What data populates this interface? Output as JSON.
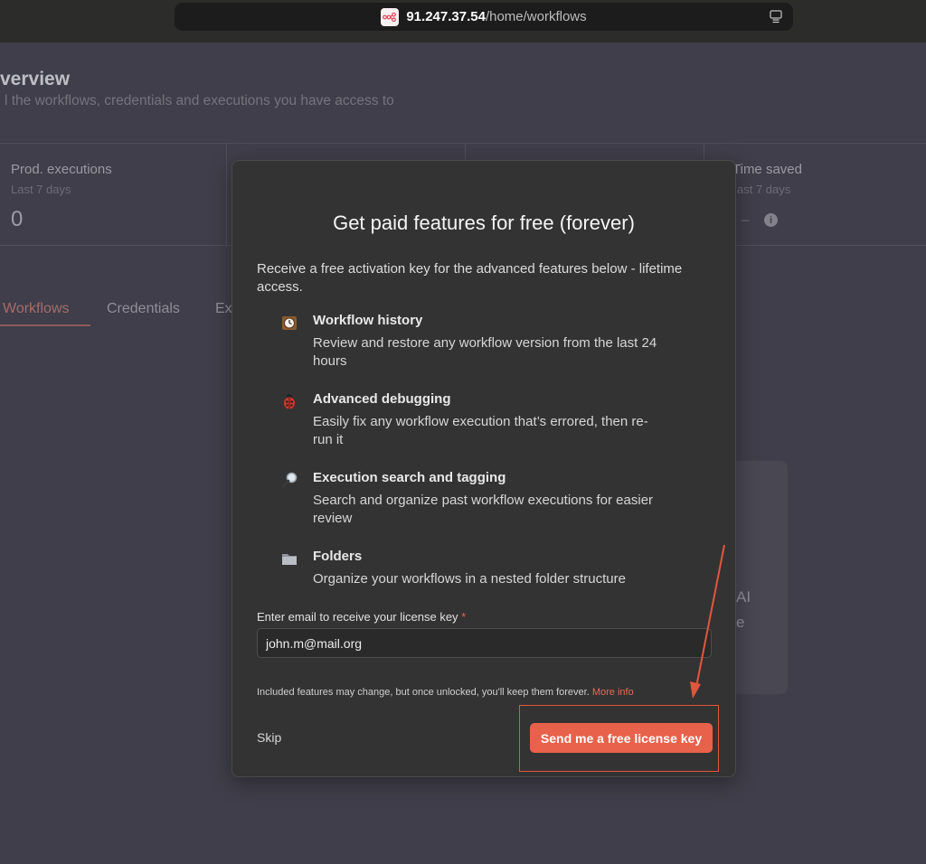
{
  "browser": {
    "url_host": "91.247.37.54",
    "url_path": "/home/workflows"
  },
  "background": {
    "title": "verview",
    "subtitle": "l the workflows, credentials and executions you have access to",
    "stats": [
      {
        "label": "Prod. executions",
        "sub": "Last 7 days",
        "value": "0"
      },
      {
        "label": "Time saved",
        "sub": "ast 7 days",
        "value": "–"
      }
    ],
    "tabs": [
      "Workflows",
      "Credentials",
      "Ex"
    ],
    "card_text": [
      "AI",
      "e"
    ]
  },
  "modal": {
    "title": "Get paid features for free (forever)",
    "intro": "Receive a free activation key for the advanced features below - lifetime access.",
    "features": [
      {
        "icon": "clock-icon",
        "title": "Workflow history",
        "desc": "Review and restore any workflow version from the last 24 hours"
      },
      {
        "icon": "ladybug-icon",
        "title": "Advanced debugging",
        "desc": "Easily fix any workflow execution that’s errored, then re-run it"
      },
      {
        "icon": "magnifier-icon",
        "title": "Execution search and tagging",
        "desc": "Search and organize past workflow executions for easier review"
      },
      {
        "icon": "folder-icon",
        "title": "Folders",
        "desc": "Organize your workflows in a nested folder structure"
      }
    ],
    "email_label": "Enter email to receive your license key",
    "email_required": "*",
    "email_value": "john.m@mail.org",
    "disclaimer": "Included features may change, but once unlocked, you'll keep them forever.",
    "more_info": "More info",
    "skip_label": "Skip",
    "send_label": "Send me a free license key"
  },
  "colors": {
    "accent": "#e8614a",
    "annotation": "#e0573d"
  }
}
